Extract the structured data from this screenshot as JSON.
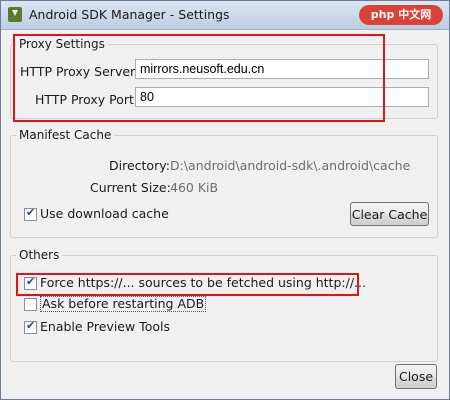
{
  "window": {
    "title": "Android SDK Manager - Settings",
    "watermark": "php 中文网"
  },
  "proxy": {
    "legend": "Proxy Settings",
    "server_label": "HTTP Proxy Server",
    "server_value": "mirrors.neusoft.edu.cn",
    "port_label": "HTTP Proxy Port",
    "port_value": "80"
  },
  "manifest": {
    "legend": "Manifest Cache",
    "directory_label": "Directory:",
    "directory_value": "D:\\android\\android-sdk\\.android\\cache",
    "size_label": "Current Size:",
    "size_value": "460 KiB",
    "use_cache_label": "Use download cache",
    "use_cache_checked": true,
    "clear_button": "Clear Cache"
  },
  "others": {
    "legend": "Others",
    "force_http_label": "Force https://... sources to be fetched using http://...",
    "force_http_checked": true,
    "ask_restart_label": "Ask before restarting ADB",
    "ask_restart_checked": false,
    "preview_label": "Enable Preview Tools",
    "preview_checked": true
  },
  "footer": {
    "close_button": "Close"
  },
  "colors": {
    "highlight": "#e0141c",
    "titlebar": "#c3d3e6"
  }
}
